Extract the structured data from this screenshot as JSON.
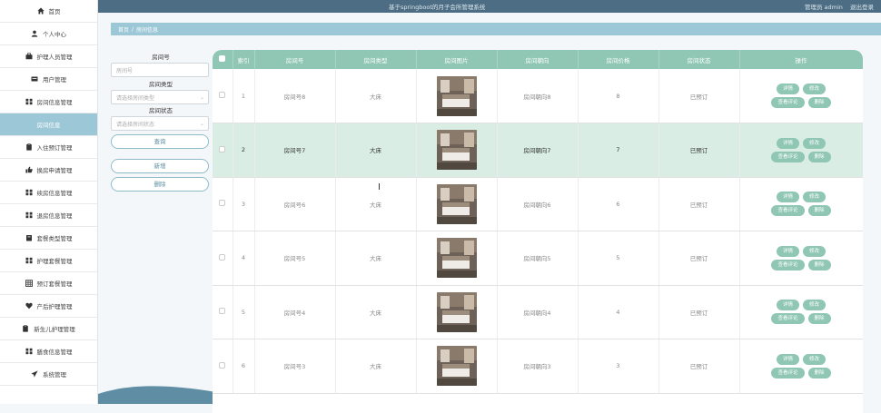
{
  "topbar": {
    "system_title": "基于springboot的月子会所管理系统",
    "user_label": "管理员 admin",
    "logout": "退出登录"
  },
  "sidebar": {
    "items": [
      {
        "label": "首页",
        "icon": "home-icon"
      },
      {
        "label": "个人中心",
        "icon": "person-icon"
      },
      {
        "label": "护理人员管理",
        "icon": "briefcase-icon"
      },
      {
        "label": "用户管理",
        "icon": "card-icon"
      },
      {
        "label": "房间信息管理",
        "icon": "grid-icon"
      },
      {
        "label": "房间信息",
        "icon": "",
        "active": true
      },
      {
        "label": "入住预订管理",
        "icon": "clipboard-icon"
      },
      {
        "label": "换房申请管理",
        "icon": "thumb-icon"
      },
      {
        "label": "续房信息管理",
        "icon": "grid-icon"
      },
      {
        "label": "退房信息管理",
        "icon": "grid-icon"
      },
      {
        "label": "套餐类型管理",
        "icon": "box-icon"
      },
      {
        "label": "护理套餐管理",
        "icon": "grid-icon"
      },
      {
        "label": "预订套餐管理",
        "icon": "table-icon"
      },
      {
        "label": "产后护理管理",
        "icon": "heart-icon"
      },
      {
        "label": "新生儿护理管理",
        "icon": "clipboard-icon"
      },
      {
        "label": "膳食信息管理",
        "icon": "grid-icon"
      },
      {
        "label": "系统管理",
        "icon": "send-icon"
      }
    ]
  },
  "breadcrumb": {
    "home": "首页",
    "sep": "/",
    "current": "房间信息"
  },
  "search": {
    "room_no_label": "房间号",
    "room_no_placeholder": "房间号",
    "room_type_label": "房间类型",
    "room_type_placeholder": "请选择房间类型",
    "room_status_label": "房间状态",
    "room_status_placeholder": "请选择房间状态",
    "query_button": "查询",
    "add_button": "新增",
    "delete_button": "删除"
  },
  "table": {
    "headers": [
      "索引",
      "房间号",
      "房间类型",
      "房间图片",
      "房间朝向",
      "房间价格",
      "房间状态",
      "操作"
    ],
    "ops": {
      "detail": "详情",
      "edit": "修改",
      "review": "查看评论",
      "delete": "删除"
    },
    "rows": [
      {
        "index": "1",
        "room_no": "房间号8",
        "room_type": "大床",
        "orientation": "房间朝向8",
        "price": "8",
        "status": "已预订"
      },
      {
        "index": "2",
        "room_no": "房间号7",
        "room_type": "大床",
        "orientation": "房间朝向7",
        "price": "7",
        "status": "已预订",
        "highlight": true
      },
      {
        "index": "3",
        "room_no": "房间号6",
        "room_type": "大床",
        "orientation": "房间朝向6",
        "price": "6",
        "status": "已预订"
      },
      {
        "index": "4",
        "room_no": "房间号5",
        "room_type": "大床",
        "orientation": "房间朝向5",
        "price": "5",
        "status": "已预订"
      },
      {
        "index": "5",
        "room_no": "房间号4",
        "room_type": "大床",
        "orientation": "房间朝向4",
        "price": "4",
        "status": "已预订"
      },
      {
        "index": "6",
        "room_no": "房间号3",
        "room_type": "大床",
        "orientation": "房间朝向3",
        "price": "3",
        "status": "已预订"
      }
    ]
  },
  "colors": {
    "accent": "#8fc6b4",
    "topbar": "#4c6d83",
    "breadcrumb": "#9cc7d6"
  }
}
